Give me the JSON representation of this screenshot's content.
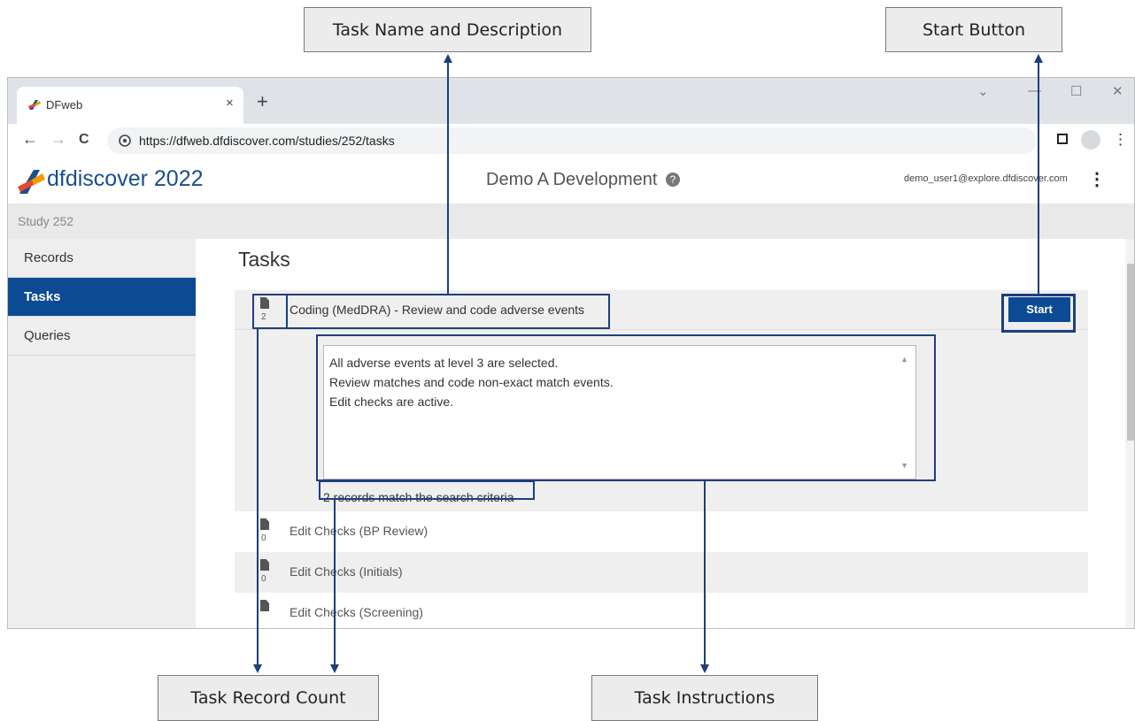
{
  "annotations": {
    "task_name": "Task Name and Description",
    "start_button": "Start Button",
    "task_record_count": "Task Record Count",
    "task_instructions": "Task Instructions"
  },
  "browser": {
    "tab_title": "DFweb",
    "tab_close": "×",
    "new_tab": "+",
    "url": "https://dfweb.dfdiscover.com/studies/252/tasks",
    "controls": {
      "minimize": "—",
      "maximize": "☐",
      "close": "✕",
      "dropdown": "⌄"
    },
    "nav": {
      "back": "←",
      "forward": "→",
      "reload": "C"
    }
  },
  "app": {
    "logo_text": "dfdiscover",
    "logo_year": "2022",
    "study_title": "Demo A Development",
    "help_glyph": "?",
    "user_email": "demo_user1@explore.dfdiscover.com",
    "menu_glyph": "⋮",
    "study_label": "Study 252"
  },
  "sidebar": {
    "items": [
      {
        "label": "Records",
        "active": false
      },
      {
        "label": "Tasks",
        "active": true
      },
      {
        "label": "Queries",
        "active": false
      }
    ]
  },
  "main": {
    "title": "Tasks",
    "tasks": [
      {
        "name": "Coding (MedDRA) - Review and code adverse events",
        "count": "2",
        "start_label": "Start",
        "instructions": [
          "All adverse events at level 3 are selected.",
          "Review matches and code non-exact match events.",
          "Edit checks are active."
        ],
        "match_text": "2 records match the search criteria"
      },
      {
        "name": "Edit Checks (BP Review)",
        "count": "0"
      },
      {
        "name": "Edit Checks (Initials)",
        "count": "0"
      },
      {
        "name": "Edit Checks (Screening)",
        "count": ""
      }
    ]
  },
  "colors": {
    "accent": "#0d4a94",
    "annotation_line": "#1d3f7c",
    "logo": "#1a4e8f"
  },
  "icons": {
    "favicon": "dfdiscover-logo-icon",
    "doc": "document-icon",
    "secure": "lock-icon"
  }
}
